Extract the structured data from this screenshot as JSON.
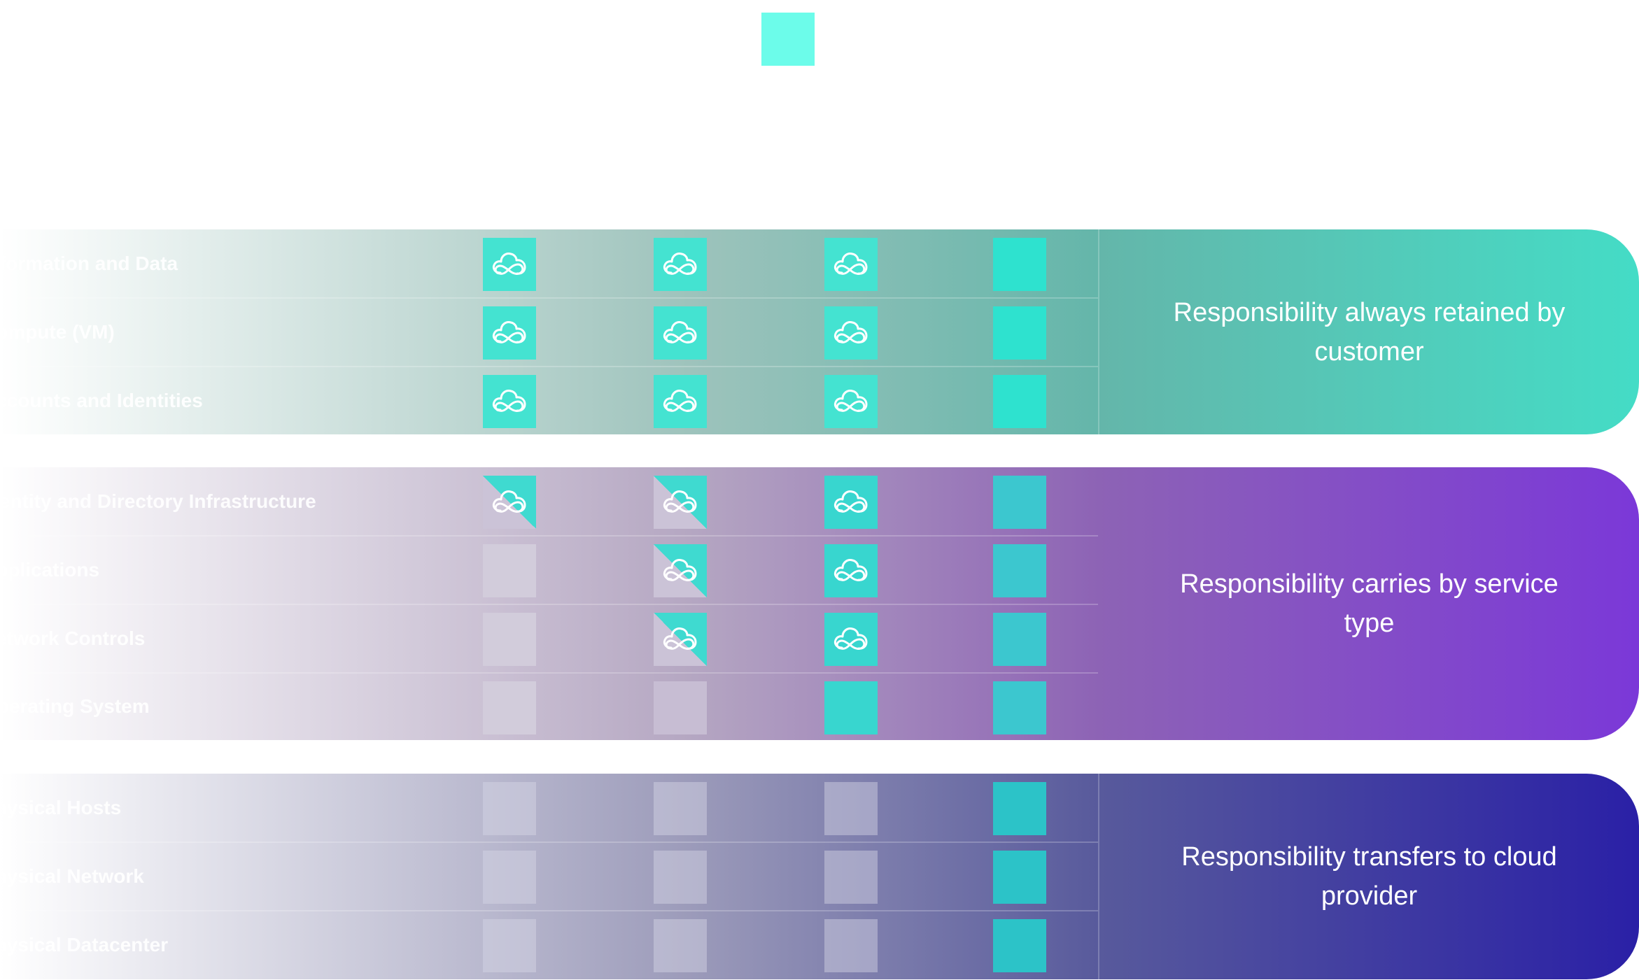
{
  "legend": {
    "swatch_color": "#6cfcea"
  },
  "bands": [
    {
      "id": "customer",
      "description": "Responsibility always retained by customer",
      "rows": [
        {
          "label": "Information and Data",
          "cells": [
            "full",
            "full",
            "full",
            "provider"
          ]
        },
        {
          "label": "Compute (VM)",
          "cells": [
            "full",
            "full",
            "full",
            "provider"
          ]
        },
        {
          "label": "Accounts and Identities",
          "cells": [
            "full",
            "full",
            "full",
            "provider"
          ]
        }
      ]
    },
    {
      "id": "service",
      "description": "Responsibility carries by service type",
      "rows": [
        {
          "label": "Identity and Directory Infrastructure",
          "cells": [
            "split",
            "split",
            "full",
            "provider"
          ]
        },
        {
          "label": "Applications",
          "cells": [
            "none",
            "split",
            "full",
            "provider"
          ]
        },
        {
          "label": "Network Controls",
          "cells": [
            "none",
            "split",
            "full",
            "provider"
          ]
        },
        {
          "label": "Operating System",
          "cells": [
            "none",
            "none",
            "full-plain",
            "provider"
          ]
        }
      ]
    },
    {
      "id": "provider",
      "description": "Responsibility transfers to cloud provider",
      "rows": [
        {
          "label": "Physical Hosts",
          "cells": [
            "none",
            "none",
            "none",
            "provider"
          ]
        },
        {
          "label": "Physical Network",
          "cells": [
            "none",
            "none",
            "none",
            "provider"
          ]
        },
        {
          "label": "Physical Datacenter",
          "cells": [
            "none",
            "none",
            "none",
            "provider"
          ]
        }
      ]
    }
  ],
  "colors": {
    "customer_accent": "#44dcc6",
    "service_accent": "#7b38d8",
    "provider_accent": "#2a20a6",
    "cell_teal": "#44e3d1"
  },
  "icon": "cloud-infinity-icon"
}
